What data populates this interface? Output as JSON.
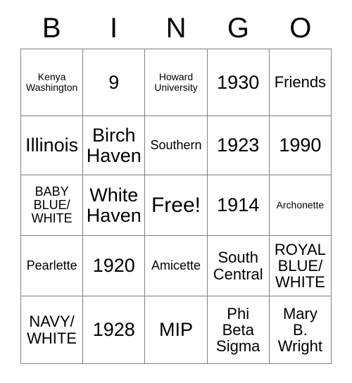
{
  "card": {
    "type": "bingo-card",
    "columns": 5,
    "rows": 5,
    "header": [
      "B",
      "I",
      "N",
      "G",
      "O"
    ],
    "free_space": {
      "row": 3,
      "column": 3,
      "label": "Free!"
    },
    "grid": [
      [
        {
          "text": "Kenya\nWashington",
          "size": "fs-xs"
        },
        {
          "text": "9",
          "size": "fs-lg"
        },
        {
          "text": "Howard\nUniversity",
          "size": "fs-xs"
        },
        {
          "text": "1930",
          "size": "fs-lg"
        },
        {
          "text": "Friends",
          "size": "fs-md"
        }
      ],
      [
        {
          "text": "Illinois",
          "size": "fs-lg"
        },
        {
          "text": "Birch\nHaven",
          "size": "fs-lg"
        },
        {
          "text": "Southern",
          "size": "fs-sm"
        },
        {
          "text": "1923",
          "size": "fs-lg"
        },
        {
          "text": "1990",
          "size": "fs-lg"
        }
      ],
      [
        {
          "text": "BABY\nBLUE/\nWHITE",
          "size": "fs-sm"
        },
        {
          "text": "White\nHaven",
          "size": "fs-lg"
        },
        {
          "text": "Free!",
          "size": "fs-xl"
        },
        {
          "text": "1914",
          "size": "fs-lg"
        },
        {
          "text": "Archonette",
          "size": "fs-xs"
        }
      ],
      [
        {
          "text": "Pearlette",
          "size": "fs-sm"
        },
        {
          "text": "1920",
          "size": "fs-lg"
        },
        {
          "text": "Amicette",
          "size": "fs-sm"
        },
        {
          "text": "South\nCentral",
          "size": "fs-md"
        },
        {
          "text": "ROYAL\nBLUE/\nWHITE",
          "size": "fs-md"
        }
      ],
      [
        {
          "text": "NAVY/\nWHITE",
          "size": "fs-md"
        },
        {
          "text": "1928",
          "size": "fs-lg"
        },
        {
          "text": "MIP",
          "size": "fs-lg"
        },
        {
          "text": "Phi\nBeta\nSigma",
          "size": "fs-md"
        },
        {
          "text": "Mary\nB.\nWright",
          "size": "fs-md"
        }
      ]
    ],
    "colors": {
      "background": "#ffffff",
      "text": "#000000",
      "grid_line": "#808080"
    }
  }
}
